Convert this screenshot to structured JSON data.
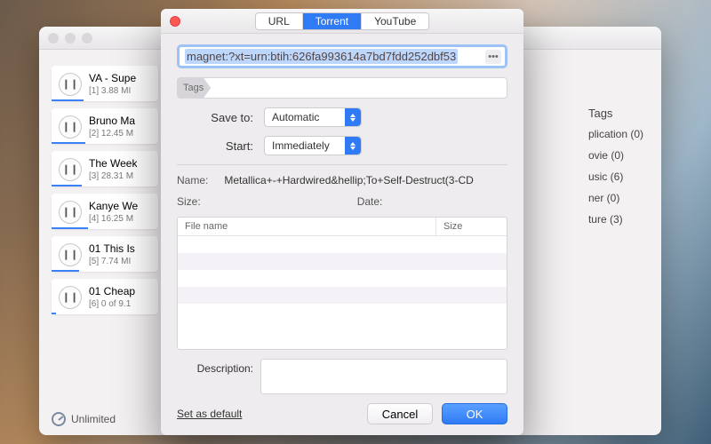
{
  "modal": {
    "tabs": [
      "URL",
      "Torrent",
      "YouTube"
    ],
    "active_tab_index": 1,
    "url_value": "magnet:?xt=urn:btih:626fa993614a7bd7fdd252dbf53",
    "tag_placeholder": "Tags",
    "save_to_label": "Save to:",
    "save_to_value": "Automatic",
    "start_label": "Start:",
    "start_value": "Immediately",
    "name_label": "Name:",
    "name_value": "Metallica+-+Hardwired&hellip;To+Self-Destruct(3-CD",
    "size_label": "Size:",
    "size_value": "",
    "date_label": "Date:",
    "date_value": "",
    "file_columns": [
      "File name",
      "Size"
    ],
    "description_label": "Description:",
    "description_value": "",
    "set_default": "Set as default",
    "cancel": "Cancel",
    "ok": "OK"
  },
  "downloads": [
    {
      "title": "VA - Supe",
      "index": "[1]",
      "meta": "3.88 MI",
      "progress": 30
    },
    {
      "title": "Bruno Ma",
      "index": "[2]",
      "meta": "12.45 M",
      "progress": 32
    },
    {
      "title": "The Week",
      "index": "[3]",
      "meta": "28.31 M",
      "progress": 28
    },
    {
      "title": "Kanye We",
      "index": "[4]",
      "meta": "16.25 M",
      "progress": 34
    },
    {
      "title": "01 This Is",
      "index": "[5]",
      "meta": "7.74 MI",
      "progress": 26
    },
    {
      "title": "01 Cheap",
      "index": "[6]",
      "meta": "0 of 9.1",
      "progress": 4
    }
  ],
  "tags_heading": "Tags",
  "tags": [
    "plication (0)",
    "ovie (0)",
    "usic (6)",
    "ner (0)",
    "ture (3)"
  ],
  "footer_label": "Unlimited"
}
